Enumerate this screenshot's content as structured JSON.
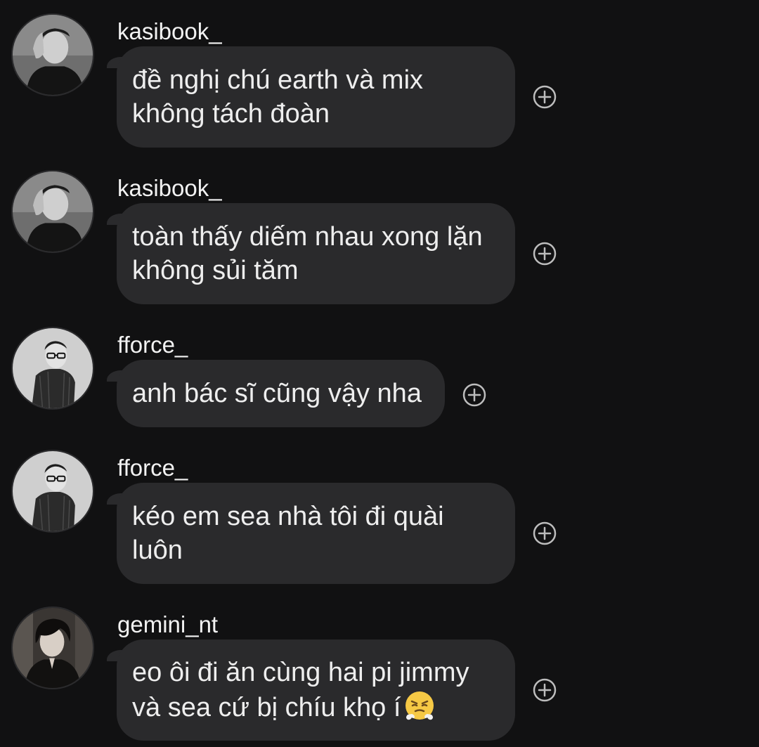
{
  "messages": [
    {
      "username": "kasibook_",
      "text": "đề nghị chú earth và mix\nkhông tách đoàn",
      "avatar": "portrait-hand-on-head",
      "reaction_icon": "add-reaction-icon"
    },
    {
      "username": "kasibook_",
      "text": "toàn thấy diếm nhau xong lặn\nkhông sủi tăm",
      "avatar": "portrait-hand-on-head",
      "reaction_icon": "add-reaction-icon"
    },
    {
      "username": "fforce_",
      "text": "anh bác sĩ cũng vậy nha",
      "avatar": "portrait-glasses-suit",
      "reaction_icon": "add-reaction-icon"
    },
    {
      "username": "fforce_",
      "text": "kéo em sea nhà tôi đi quài\nluôn",
      "avatar": "portrait-glasses-suit",
      "reaction_icon": "add-reaction-icon"
    },
    {
      "username": "gemini_nt",
      "text": "eo ôi đi ăn cùng hai pi jimmy\nvà sea cứ bị chíu khọ í",
      "emoji": "face-with-steam-from-nose",
      "avatar": "portrait-dark-hair",
      "reaction_icon": "add-reaction-icon"
    }
  ],
  "colors": {
    "background": "#111112",
    "bubble": "#2a2a2c",
    "text": "#eeeeee",
    "icon": "#bdbdbd"
  }
}
